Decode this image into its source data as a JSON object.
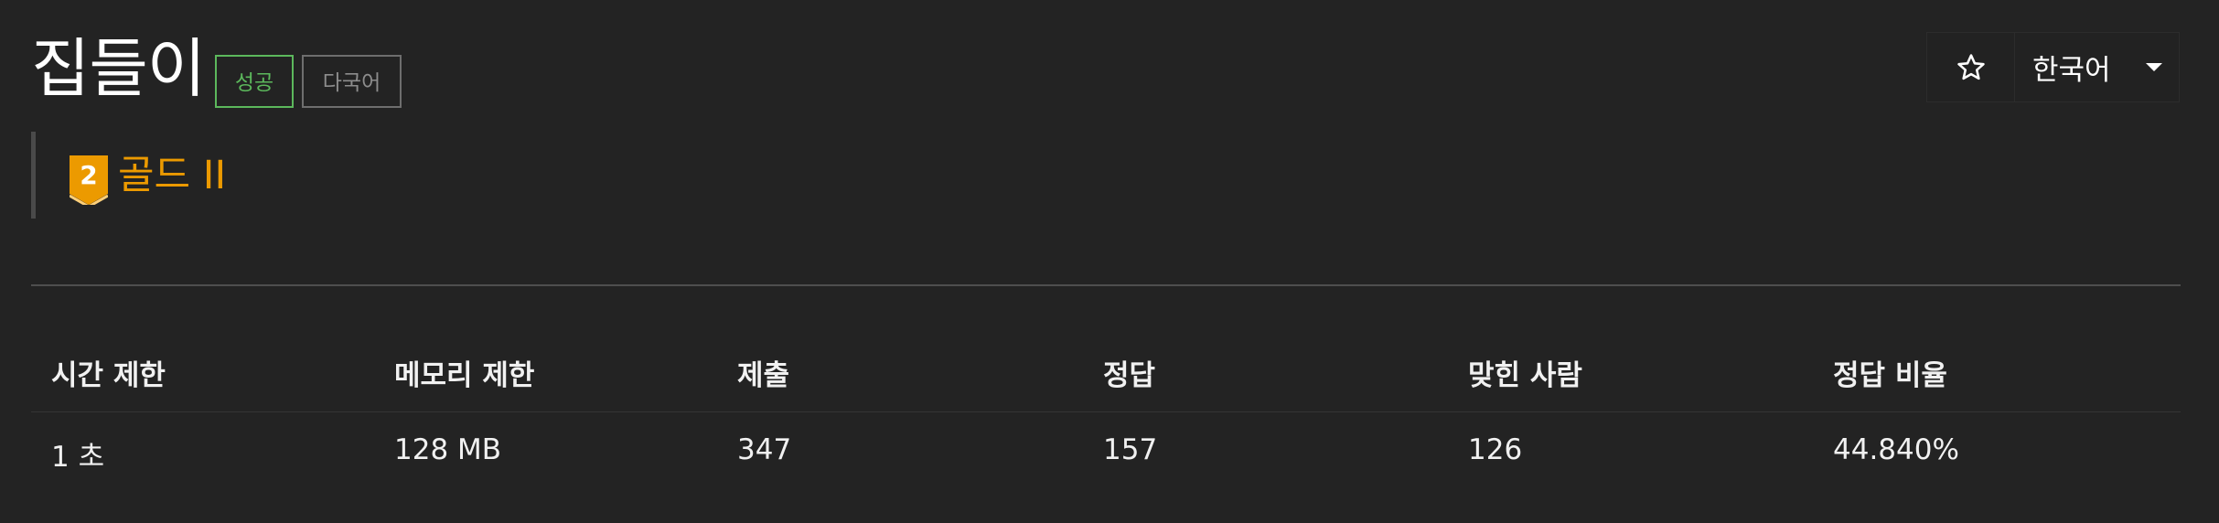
{
  "problem": {
    "title": "집들이",
    "labels": {
      "success": "성공",
      "multilang": "다국어"
    }
  },
  "tier": {
    "icon": "gold-tier-badge-icon",
    "badge_number": "2",
    "name": "골드 II",
    "color": "#ec9a00"
  },
  "toolbar": {
    "star_icon": "star-outline-icon",
    "language": "한국어",
    "caret_icon": "caret-down-icon"
  },
  "table": {
    "headers": [
      "시간 제한",
      "메모리 제한",
      "제출",
      "정답",
      "맞힌 사람",
      "정답 비율"
    ],
    "rows": [
      [
        "1 초",
        "128 MB",
        "347",
        "157",
        "126",
        "44.840%"
      ]
    ]
  },
  "colors": {
    "background": "#232323",
    "success": "#5cb85c",
    "muted": "#8d8d8d"
  }
}
